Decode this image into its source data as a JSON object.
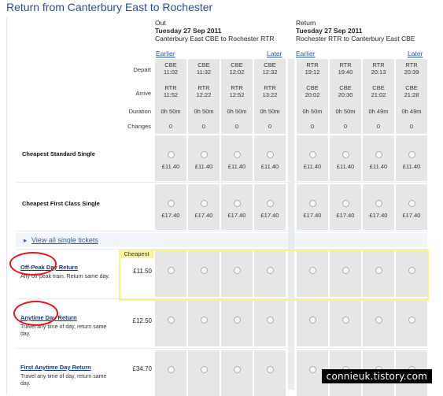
{
  "title": "Return from Canterbury East to Rochester",
  "out": {
    "label": "Out",
    "date": "Tuesday 27 Sep 2011",
    "route": "Canterbury East CBE to Rochester RTR",
    "earlier": "Earlier",
    "later": "Later",
    "columns": [
      {
        "depart": [
          "CBE",
          "11:02"
        ],
        "arrive": [
          "RTR",
          "11:52"
        ],
        "duration": "0h 50m",
        "changes": "0"
      },
      {
        "depart": [
          "CBE",
          "11:32"
        ],
        "arrive": [
          "RTR",
          "12:22"
        ],
        "duration": "0h 50m",
        "changes": "0"
      },
      {
        "depart": [
          "CBE",
          "12:02"
        ],
        "arrive": [
          "RTR",
          "12:52"
        ],
        "duration": "0h 50m",
        "changes": "0"
      },
      {
        "depart": [
          "CBE",
          "12:32"
        ],
        "arrive": [
          "RTR",
          "13:22"
        ],
        "duration": "0h 50m",
        "changes": "0"
      }
    ]
  },
  "ret": {
    "label": "Return",
    "date": "Tuesday 27 Sep 2011",
    "route": "Rochester RTR to Canterbury East CBE",
    "earlier": "Earlier",
    "later": "Later",
    "columns": [
      {
        "depart": [
          "RTR",
          "19:12"
        ],
        "arrive": [
          "CBE",
          "20:02"
        ],
        "duration": "0h 50m",
        "changes": "0"
      },
      {
        "depart": [
          "RTR",
          "19:40"
        ],
        "arrive": [
          "CBE",
          "20:30"
        ],
        "duration": "0h 50m",
        "changes": "0"
      },
      {
        "depart": [
          "RTR",
          "20:13"
        ],
        "arrive": [
          "CBE",
          "21:02"
        ],
        "duration": "0h 49m",
        "changes": "0"
      },
      {
        "depart": [
          "RTR",
          "20:39"
        ],
        "arrive": [
          "CBE",
          "21:28"
        ],
        "duration": "0h 49m",
        "changes": "0"
      }
    ]
  },
  "row_labels": {
    "depart": "Depart",
    "arrive": "Arrive",
    "duration": "Duration",
    "changes": "Changes"
  },
  "singles": [
    {
      "label": "Cheapest Standard Single",
      "price": "£11.40"
    },
    {
      "label": "Cheapest First Class Single",
      "price": "£17.40"
    }
  ],
  "view_all": "View all single tickets",
  "cheapest_badge": "Cheapest",
  "fares": [
    {
      "title": "Off-Peak Day Return",
      "desc": "Any off-peak train. Return same day.",
      "price": "£11.50"
    },
    {
      "title": "Anytime Day Return",
      "desc": "Travel any time of day, return same day.",
      "price": "£12.50"
    },
    {
      "title": "First Anytime Day Return",
      "desc": "Travel any time of day, return same day.",
      "price": "£34.70"
    }
  ],
  "watermark": "connieuk.tistory.com",
  "colors": {
    "title": "#2b4e86",
    "cell": "#e6e6e6",
    "highlight": "#f7f28a",
    "annotation": "#e0151f"
  }
}
